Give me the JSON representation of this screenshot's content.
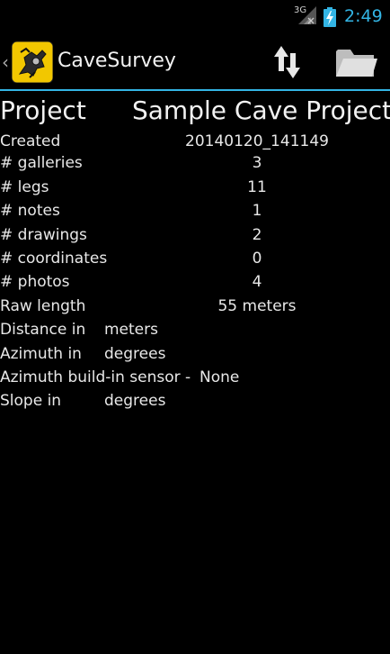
{
  "status_bar": {
    "network": "3G",
    "time": "2:49",
    "accent": "#33b5e5"
  },
  "action_bar": {
    "back_icon": "chevron-left-icon",
    "app_icon": "cave-survey-logo",
    "title": "CaveSurvey",
    "sort_icon": "up-down-arrows-icon",
    "folder_icon": "folder-open-icon"
  },
  "project": {
    "label": "Project",
    "value": "Sample Cave Project"
  },
  "stats": [
    {
      "label": "Created",
      "value": "20140120_141149"
    },
    {
      "label": "# galleries",
      "value": "3"
    },
    {
      "label": "# legs",
      "value": "11"
    },
    {
      "label": "# notes",
      "value": "1"
    },
    {
      "label": "# drawings",
      "value": "2"
    },
    {
      "label": "# coordinates",
      "value": "0"
    },
    {
      "label": "# photos",
      "value": "4"
    },
    {
      "label": "Raw length",
      "value": "55 meters"
    }
  ],
  "settings": [
    {
      "label": "Distance in",
      "value": "meters"
    },
    {
      "label": "Azimuth in",
      "value": "degrees"
    },
    {
      "label": "Azimuth build-in sensor -",
      "value": "None"
    },
    {
      "label": "Slope in",
      "value": "degrees"
    }
  ]
}
